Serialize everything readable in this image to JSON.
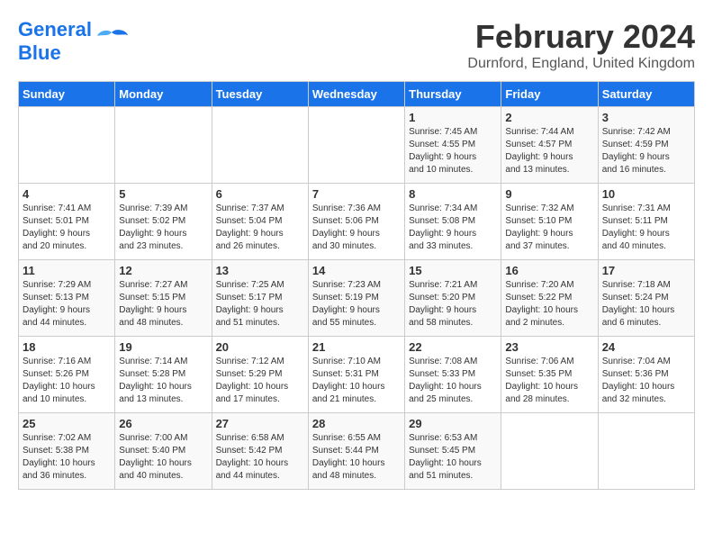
{
  "logo": {
    "line1": "General",
    "line2": "Blue"
  },
  "title": "February 2024",
  "location": "Durnford, England, United Kingdom",
  "days_of_week": [
    "Sunday",
    "Monday",
    "Tuesday",
    "Wednesday",
    "Thursday",
    "Friday",
    "Saturday"
  ],
  "weeks": [
    [
      {
        "day": "",
        "info": ""
      },
      {
        "day": "",
        "info": ""
      },
      {
        "day": "",
        "info": ""
      },
      {
        "day": "",
        "info": ""
      },
      {
        "day": "1",
        "info": "Sunrise: 7:45 AM\nSunset: 4:55 PM\nDaylight: 9 hours\nand 10 minutes."
      },
      {
        "day": "2",
        "info": "Sunrise: 7:44 AM\nSunset: 4:57 PM\nDaylight: 9 hours\nand 13 minutes."
      },
      {
        "day": "3",
        "info": "Sunrise: 7:42 AM\nSunset: 4:59 PM\nDaylight: 9 hours\nand 16 minutes."
      }
    ],
    [
      {
        "day": "4",
        "info": "Sunrise: 7:41 AM\nSunset: 5:01 PM\nDaylight: 9 hours\nand 20 minutes."
      },
      {
        "day": "5",
        "info": "Sunrise: 7:39 AM\nSunset: 5:02 PM\nDaylight: 9 hours\nand 23 minutes."
      },
      {
        "day": "6",
        "info": "Sunrise: 7:37 AM\nSunset: 5:04 PM\nDaylight: 9 hours\nand 26 minutes."
      },
      {
        "day": "7",
        "info": "Sunrise: 7:36 AM\nSunset: 5:06 PM\nDaylight: 9 hours\nand 30 minutes."
      },
      {
        "day": "8",
        "info": "Sunrise: 7:34 AM\nSunset: 5:08 PM\nDaylight: 9 hours\nand 33 minutes."
      },
      {
        "day": "9",
        "info": "Sunrise: 7:32 AM\nSunset: 5:10 PM\nDaylight: 9 hours\nand 37 minutes."
      },
      {
        "day": "10",
        "info": "Sunrise: 7:31 AM\nSunset: 5:11 PM\nDaylight: 9 hours\nand 40 minutes."
      }
    ],
    [
      {
        "day": "11",
        "info": "Sunrise: 7:29 AM\nSunset: 5:13 PM\nDaylight: 9 hours\nand 44 minutes."
      },
      {
        "day": "12",
        "info": "Sunrise: 7:27 AM\nSunset: 5:15 PM\nDaylight: 9 hours\nand 48 minutes."
      },
      {
        "day": "13",
        "info": "Sunrise: 7:25 AM\nSunset: 5:17 PM\nDaylight: 9 hours\nand 51 minutes."
      },
      {
        "day": "14",
        "info": "Sunrise: 7:23 AM\nSunset: 5:19 PM\nDaylight: 9 hours\nand 55 minutes."
      },
      {
        "day": "15",
        "info": "Sunrise: 7:21 AM\nSunset: 5:20 PM\nDaylight: 9 hours\nand 58 minutes."
      },
      {
        "day": "16",
        "info": "Sunrise: 7:20 AM\nSunset: 5:22 PM\nDaylight: 10 hours\nand 2 minutes."
      },
      {
        "day": "17",
        "info": "Sunrise: 7:18 AM\nSunset: 5:24 PM\nDaylight: 10 hours\nand 6 minutes."
      }
    ],
    [
      {
        "day": "18",
        "info": "Sunrise: 7:16 AM\nSunset: 5:26 PM\nDaylight: 10 hours\nand 10 minutes."
      },
      {
        "day": "19",
        "info": "Sunrise: 7:14 AM\nSunset: 5:28 PM\nDaylight: 10 hours\nand 13 minutes."
      },
      {
        "day": "20",
        "info": "Sunrise: 7:12 AM\nSunset: 5:29 PM\nDaylight: 10 hours\nand 17 minutes."
      },
      {
        "day": "21",
        "info": "Sunrise: 7:10 AM\nSunset: 5:31 PM\nDaylight: 10 hours\nand 21 minutes."
      },
      {
        "day": "22",
        "info": "Sunrise: 7:08 AM\nSunset: 5:33 PM\nDaylight: 10 hours\nand 25 minutes."
      },
      {
        "day": "23",
        "info": "Sunrise: 7:06 AM\nSunset: 5:35 PM\nDaylight: 10 hours\nand 28 minutes."
      },
      {
        "day": "24",
        "info": "Sunrise: 7:04 AM\nSunset: 5:36 PM\nDaylight: 10 hours\nand 32 minutes."
      }
    ],
    [
      {
        "day": "25",
        "info": "Sunrise: 7:02 AM\nSunset: 5:38 PM\nDaylight: 10 hours\nand 36 minutes."
      },
      {
        "day": "26",
        "info": "Sunrise: 7:00 AM\nSunset: 5:40 PM\nDaylight: 10 hours\nand 40 minutes."
      },
      {
        "day": "27",
        "info": "Sunrise: 6:58 AM\nSunset: 5:42 PM\nDaylight: 10 hours\nand 44 minutes."
      },
      {
        "day": "28",
        "info": "Sunrise: 6:55 AM\nSunset: 5:44 PM\nDaylight: 10 hours\nand 48 minutes."
      },
      {
        "day": "29",
        "info": "Sunrise: 6:53 AM\nSunset: 5:45 PM\nDaylight: 10 hours\nand 51 minutes."
      },
      {
        "day": "",
        "info": ""
      },
      {
        "day": "",
        "info": ""
      }
    ]
  ]
}
